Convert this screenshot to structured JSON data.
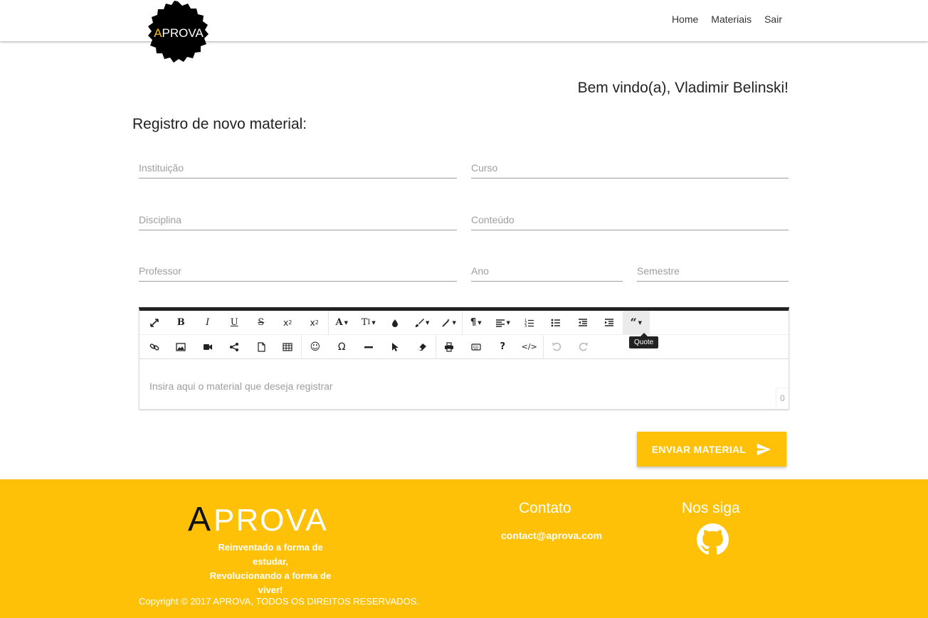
{
  "navbar": {
    "logo_text": "APROVA",
    "links": [
      {
        "label": "Home"
      },
      {
        "label": "Materiais"
      },
      {
        "label": "Sair"
      }
    ]
  },
  "main": {
    "welcome": "Bem vindo(a), Vladimir Belinski!",
    "form_title": "Registro de novo material:",
    "fields": {
      "instituicao": {
        "placeholder": "Instituição",
        "value": ""
      },
      "curso": {
        "placeholder": "Curso",
        "value": ""
      },
      "disciplina": {
        "placeholder": "Disciplina",
        "value": ""
      },
      "conteudo": {
        "placeholder": "Conteúdo",
        "value": ""
      },
      "professor": {
        "placeholder": "Professor",
        "value": ""
      },
      "ano": {
        "placeholder": "Ano",
        "value": ""
      },
      "semestre": {
        "placeholder": "Semestre",
        "value": ""
      }
    },
    "editor": {
      "placeholder": "Insira aqui o material que deseja registrar",
      "char_count": "0",
      "tooltip": "Quote",
      "toolbar_row1": [
        "fullscreen-icon",
        "bold-icon",
        "italic-icon",
        "underline-icon",
        "strikethrough-icon",
        "subscript-icon",
        "superscript-icon",
        "font-family-icon",
        "font-size-icon",
        "color-icon",
        "paint-brush-icon",
        "magic-icon",
        "paragraph-icon",
        "align-icon",
        "ordered-list-icon",
        "unordered-list-icon",
        "outdent-icon",
        "indent-icon",
        "quote-icon"
      ],
      "toolbar_row2": [
        "link-icon",
        "image-icon",
        "video-icon",
        "share-icon",
        "file-icon",
        "table-icon",
        "emoticon-icon",
        "special-char-icon",
        "horizontal-line-icon",
        "select-all-icon",
        "clear-format-icon",
        "print-icon",
        "keyboard-icon",
        "help-icon",
        "code-view-icon",
        "undo-icon",
        "redo-icon"
      ]
    },
    "submit_label": "ENVIAR MATERIAL"
  },
  "footer": {
    "logo_text": "APROVA",
    "tagline_1": "Reinventado a forma de estudar,",
    "tagline_2": "Revolucionando a forma de viver!",
    "contact_title": "Contato",
    "contact_email": "contact@aprova.com",
    "follow_title": "Nos siga",
    "copyright": "Copyright © 2017 APROVA, TODOS OS DIREITOS RESERVADOS."
  },
  "colors": {
    "accent": "#ffc107",
    "editor_border_top": "#222222",
    "logo_badge": "#000000"
  }
}
